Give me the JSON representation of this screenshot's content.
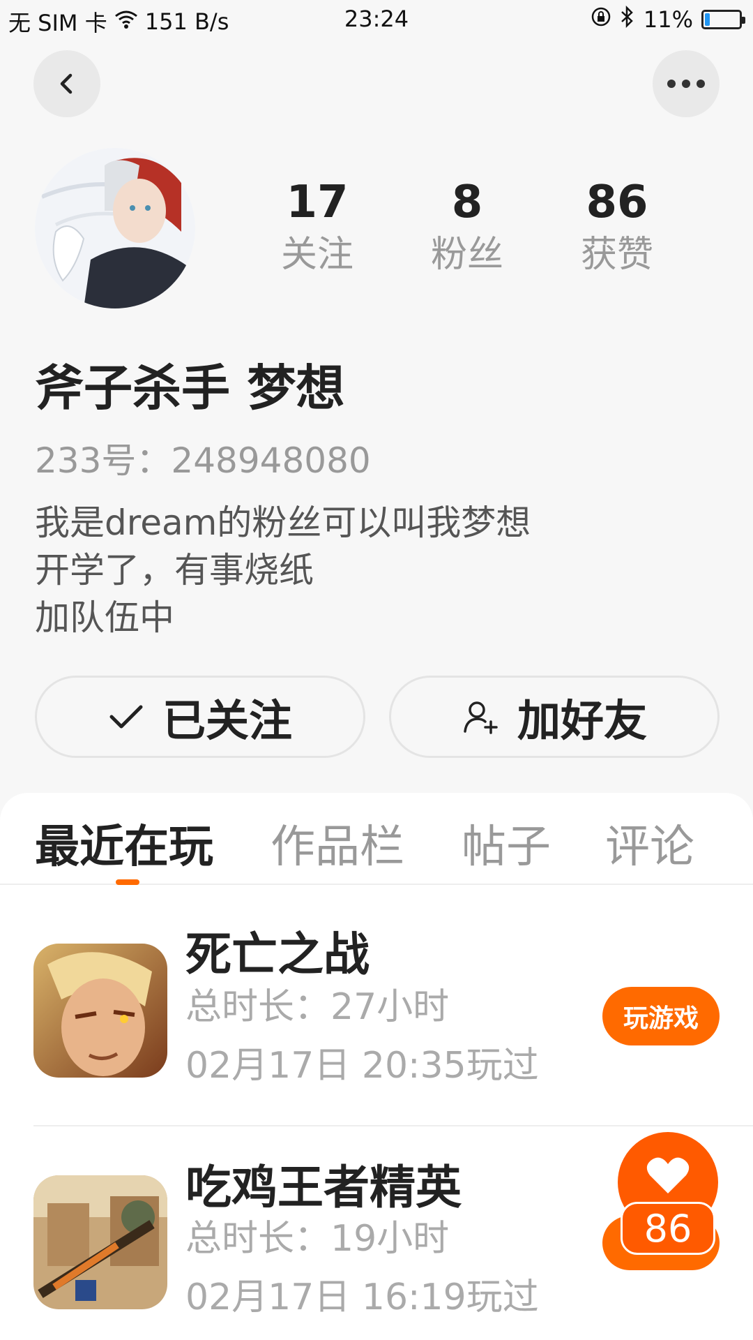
{
  "status_bar": {
    "carrier": "无 SIM 卡",
    "speed": "151 B/s",
    "time": "23:24",
    "battery": "11%"
  },
  "nav": {
    "back_icon": "chevron-left-icon",
    "more_icon": "more-horizontal-icon"
  },
  "profile": {
    "stats": [
      {
        "value": "17",
        "label": "关注"
      },
      {
        "value": "8",
        "label": "粉丝"
      },
      {
        "value": "86",
        "label": "获赞"
      }
    ],
    "name": "斧子杀手 梦想",
    "uid": "233号：248948080",
    "bio": [
      "我是dream的粉丝可以叫我梦想",
      "开学了，有事烧纸",
      "加队伍中"
    ]
  },
  "actions": {
    "follow_label": "已关注",
    "add_friend_label": "加好友"
  },
  "tabs": [
    "最近在玩",
    "作品栏",
    "帖子",
    "评论"
  ],
  "games": [
    {
      "title": "死亡之战",
      "duration": "总时长：27小时",
      "last_played": "02月17日 20:35玩过",
      "button": "玩游戏"
    },
    {
      "title": "吃鸡王者精英",
      "duration": "总时长：19小时",
      "last_played": "02月17日 16:19玩过"
    }
  ],
  "like_badge": {
    "count": "86"
  },
  "colors": {
    "accent": "#ff6a00",
    "battery": "#2196f3"
  }
}
